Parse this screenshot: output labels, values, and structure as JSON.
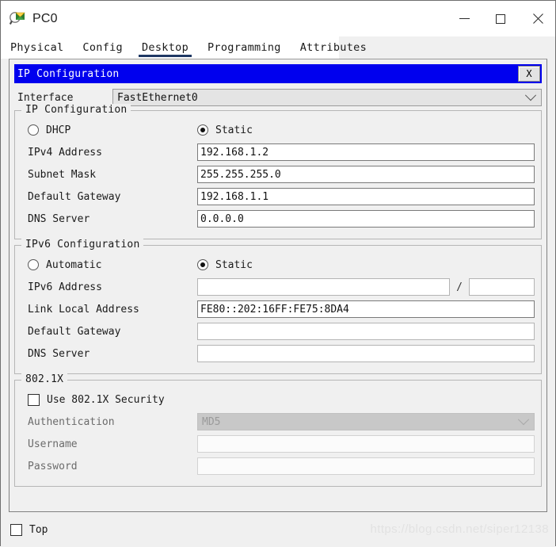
{
  "window": {
    "title": "PC0",
    "icon": "packet-tracer-pc-icon",
    "buttons": {
      "minimize": "minimize-icon",
      "maximize": "maximize-icon",
      "close": "close-icon"
    }
  },
  "tabs": [
    {
      "label": "Physical",
      "active": false
    },
    {
      "label": "Config",
      "active": false
    },
    {
      "label": "Desktop",
      "active": true
    },
    {
      "label": "Programming",
      "active": false
    },
    {
      "label": "Attributes",
      "active": false
    }
  ],
  "panel": {
    "title": "IP Configuration",
    "close_label": "X",
    "interface": {
      "label": "Interface",
      "value": "FastEthernet0",
      "chevron": "chevron-down-icon"
    }
  },
  "ipv4": {
    "group_title": "IP Configuration",
    "mode_dhcp": {
      "label": "DHCP",
      "selected": false
    },
    "mode_static": {
      "label": "Static",
      "selected": true
    },
    "fields": [
      {
        "label": "IPv4 Address",
        "value": "192.168.1.2"
      },
      {
        "label": "Subnet Mask",
        "value": "255.255.255.0"
      },
      {
        "label": "Default Gateway",
        "value": "192.168.1.1"
      },
      {
        "label": "DNS Server",
        "value": "0.0.0.0"
      }
    ]
  },
  "ipv6": {
    "group_title": "IPv6 Configuration",
    "mode_automatic": {
      "label": "Automatic",
      "selected": false
    },
    "mode_static": {
      "label": "Static",
      "selected": true
    },
    "address": {
      "label": "IPv6 Address",
      "value": "",
      "separator": "/",
      "prefix": ""
    },
    "link_local": {
      "label": "Link Local Address",
      "value": "FE80::202:16FF:FE75:8DA4"
    },
    "default_gateway": {
      "label": "Default Gateway",
      "value": ""
    },
    "dns_server": {
      "label": "DNS Server",
      "value": ""
    }
  },
  "dot1x": {
    "group_title": "802.1X",
    "use_security": {
      "label": "Use 802.1X Security",
      "checked": false
    },
    "authentication": {
      "label": "Authentication",
      "value": "MD5",
      "chevron": "chevron-down-icon"
    },
    "username": {
      "label": "Username",
      "value": ""
    },
    "password": {
      "label": "Password",
      "value": ""
    }
  },
  "bottom": {
    "top_checkbox": {
      "label": "Top",
      "checked": false
    },
    "watermark": "https://blog.csdn.net/siper12138"
  },
  "colors": {
    "panel_title_bg": "#0000ee",
    "tab_active_underline": "#1f3864",
    "window_bg": "#f0f0f0"
  }
}
